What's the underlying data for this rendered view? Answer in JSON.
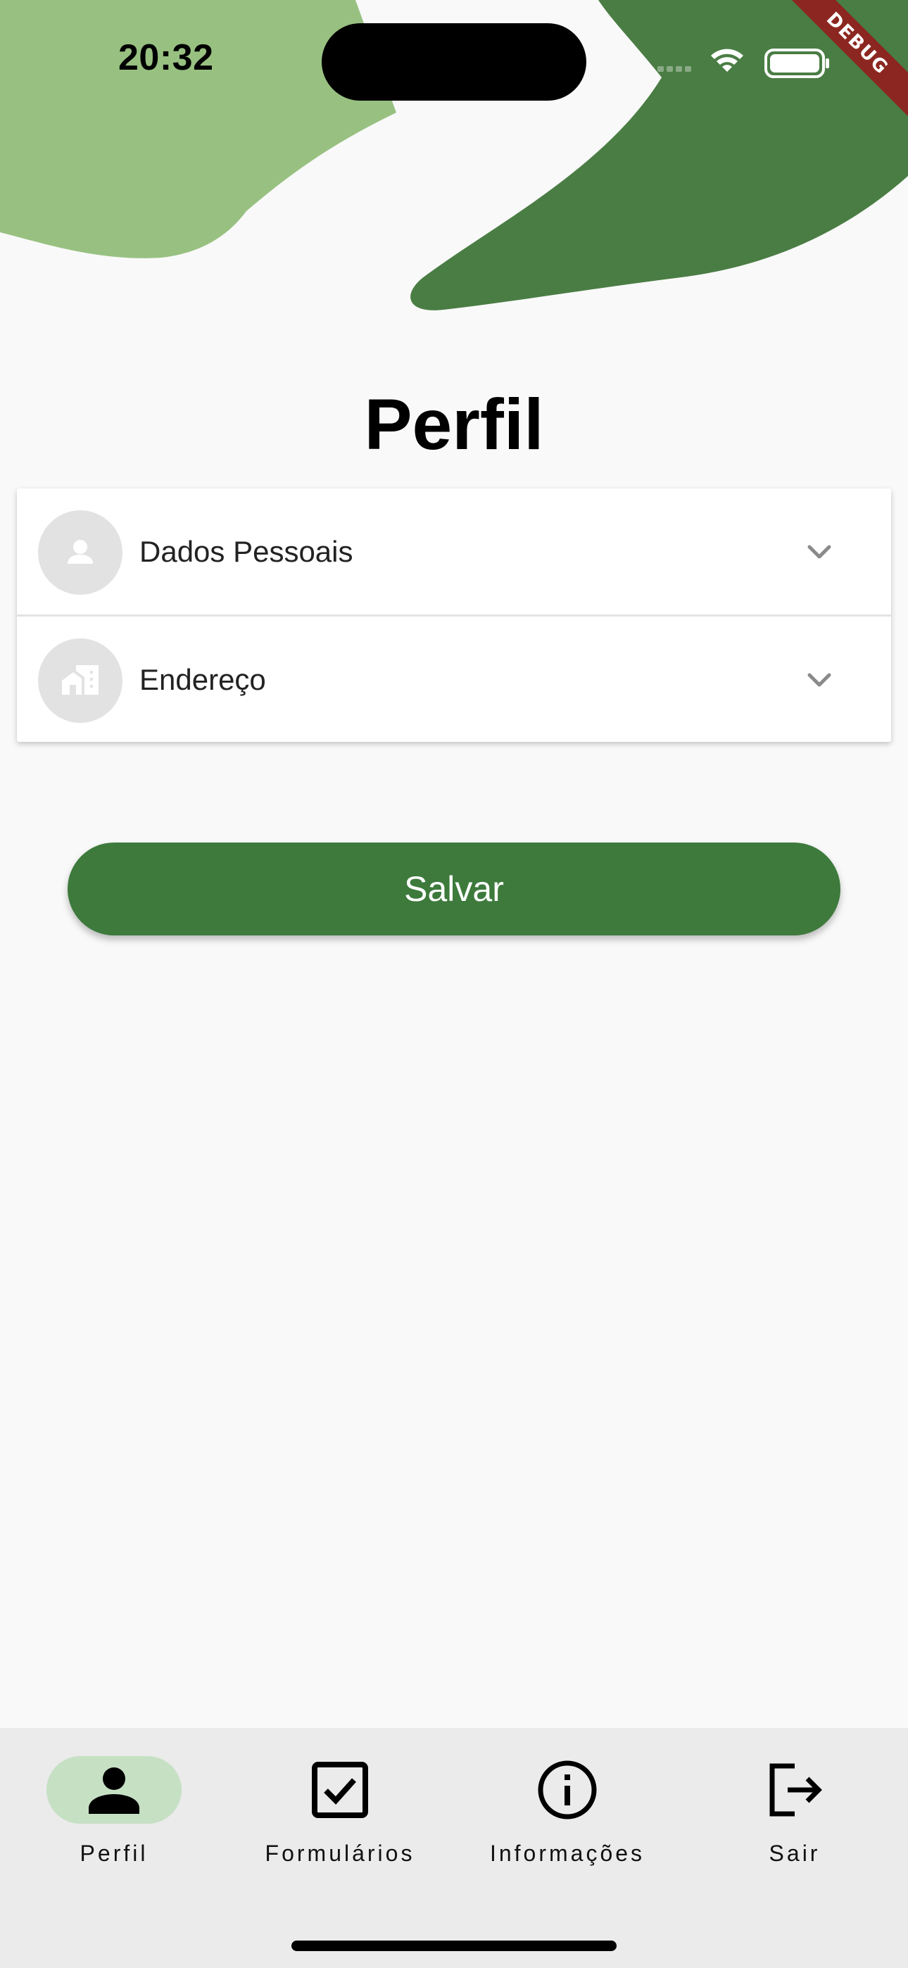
{
  "status_bar": {
    "time": "20:32",
    "icons": [
      "cellular-signal-icon",
      "wifi-icon",
      "battery-icon"
    ]
  },
  "debug_banner": "DEBUG",
  "page_title": "Perfil",
  "sections": [
    {
      "label": "Dados Pessoais",
      "icon": "person-icon",
      "expanded": false
    },
    {
      "label": "Endereço",
      "icon": "home-work-icon",
      "expanded": false
    }
  ],
  "save_button": {
    "label": "Salvar"
  },
  "bottom_nav": {
    "items": [
      {
        "label": "Perfil",
        "icon": "person-icon",
        "selected": true
      },
      {
        "label": "Formulários",
        "icon": "checkbox-icon",
        "selected": false
      },
      {
        "label": "Informações",
        "icon": "info-icon",
        "selected": false
      },
      {
        "label": "Sair",
        "icon": "logout-icon",
        "selected": false
      }
    ]
  },
  "colors": {
    "background": "#f9f9f9",
    "primary_green": "#3d7a3c",
    "decor_light_green": "#98c181",
    "decor_dark_green": "#4a7d44",
    "nav_background": "#ebebeb",
    "nav_selected_pill": "#c6e0c4",
    "debug_ribbon": "#8b2720"
  }
}
